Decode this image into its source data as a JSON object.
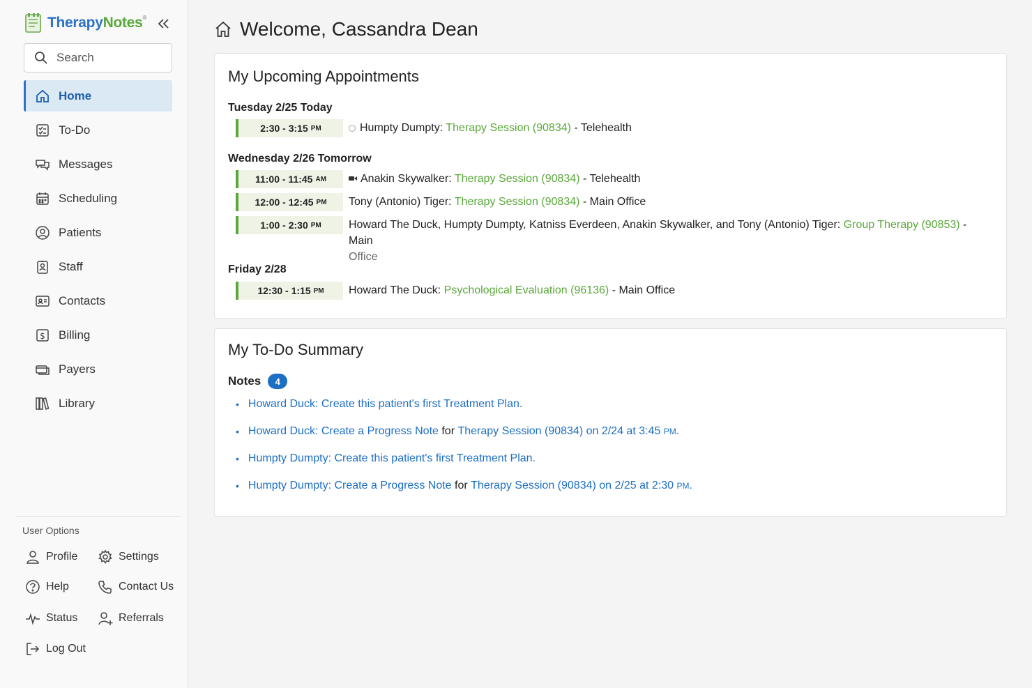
{
  "sidebar": {
    "logo": {
      "part1": "Therapy",
      "part2": "Notes",
      "reg": "®"
    },
    "search_placeholder": "Search",
    "nav": [
      {
        "label": "Home",
        "icon": "home-icon"
      },
      {
        "label": "To-Do",
        "icon": "todo-icon"
      },
      {
        "label": "Messages",
        "icon": "messages-icon"
      },
      {
        "label": "Scheduling",
        "icon": "calendar-icon"
      },
      {
        "label": "Patients",
        "icon": "patients-icon"
      },
      {
        "label": "Staff",
        "icon": "staff-icon"
      },
      {
        "label": "Contacts",
        "icon": "contacts-icon"
      },
      {
        "label": "Billing",
        "icon": "billing-icon"
      },
      {
        "label": "Payers",
        "icon": "payers-icon"
      },
      {
        "label": "Library",
        "icon": "library-icon"
      }
    ],
    "user_options": {
      "title": "User Options",
      "profile": "Profile",
      "settings": "Settings",
      "help": "Help",
      "contact": "Contact Us",
      "status": "Status",
      "referrals": "Referrals",
      "logout": "Log Out"
    }
  },
  "main": {
    "title": "Welcome, Cassandra Dean",
    "appointments": {
      "title": "My Upcoming Appointments",
      "days": [
        {
          "label": "Tuesday 2/25 Today",
          "items": [
            {
              "time": "2:30 - 3:15",
              "ampm": "PM",
              "patient": "Humpty Dumpty:",
              "service": "Therapy Session (90834)",
              "location": "- Telehealth",
              "loc2": ""
            }
          ]
        },
        {
          "label": "Wednesday 2/26 Tomorrow",
          "items": [
            {
              "time": "11:00 - 11:45",
              "ampm": "AM",
              "patient": "Anakin Skywalker:",
              "service": "Therapy Session (90834)",
              "location": "- Telehealth",
              "loc2": ""
            },
            {
              "time": "12:00 - 12:45",
              "ampm": "PM",
              "patient": "Tony (Antonio) Tiger:",
              "service": "Therapy Session (90834)",
              "location": "- Main Office",
              "loc2": ""
            },
            {
              "time": "1:00 - 2:30",
              "ampm": "PM",
              "patient": "Howard The Duck, Humpty Dumpty, Katniss Everdeen, Anakin Skywalker, and Tony (Antonio) Tiger:",
              "service": "Group Therapy (90853)",
              "location": "- Main",
              "loc2": "Office"
            }
          ]
        },
        {
          "label": "Friday 2/28",
          "items": [
            {
              "time": "12:30 - 1:15",
              "ampm": "PM",
              "patient": "Howard The Duck:",
              "service": "Psychological Evaluation (96136)",
              "location": "- Main Office",
              "loc2": ""
            }
          ]
        }
      ]
    },
    "todo": {
      "title": "My To-Do Summary",
      "notes_label": "Notes",
      "notes_count": "4",
      "items": [
        {
          "text": "Howard Duck: Create this patient's first Treatment Plan."
        },
        {
          "link": "Howard Duck: Create a Progress Note",
          "mid": "for",
          "link2": "Therapy Session (90834) on 2/24 at 3:45",
          "ampm": "PM"
        },
        {
          "text": "Humpty Dumpty: Create this patient's first Treatment Plan."
        },
        {
          "link": "Humpty Dumpty: Create a Progress Note",
          "mid": "for",
          "link2": "Therapy Session (90834) on 2/25 at 2:30",
          "ampm": "PM"
        }
      ]
    }
  },
  "colors": {
    "brand_blue": "#2d72c8",
    "brand_green": "#5aa83a",
    "link_blue": "#1d6fc4",
    "active_bg": "#dbe9f5"
  }
}
